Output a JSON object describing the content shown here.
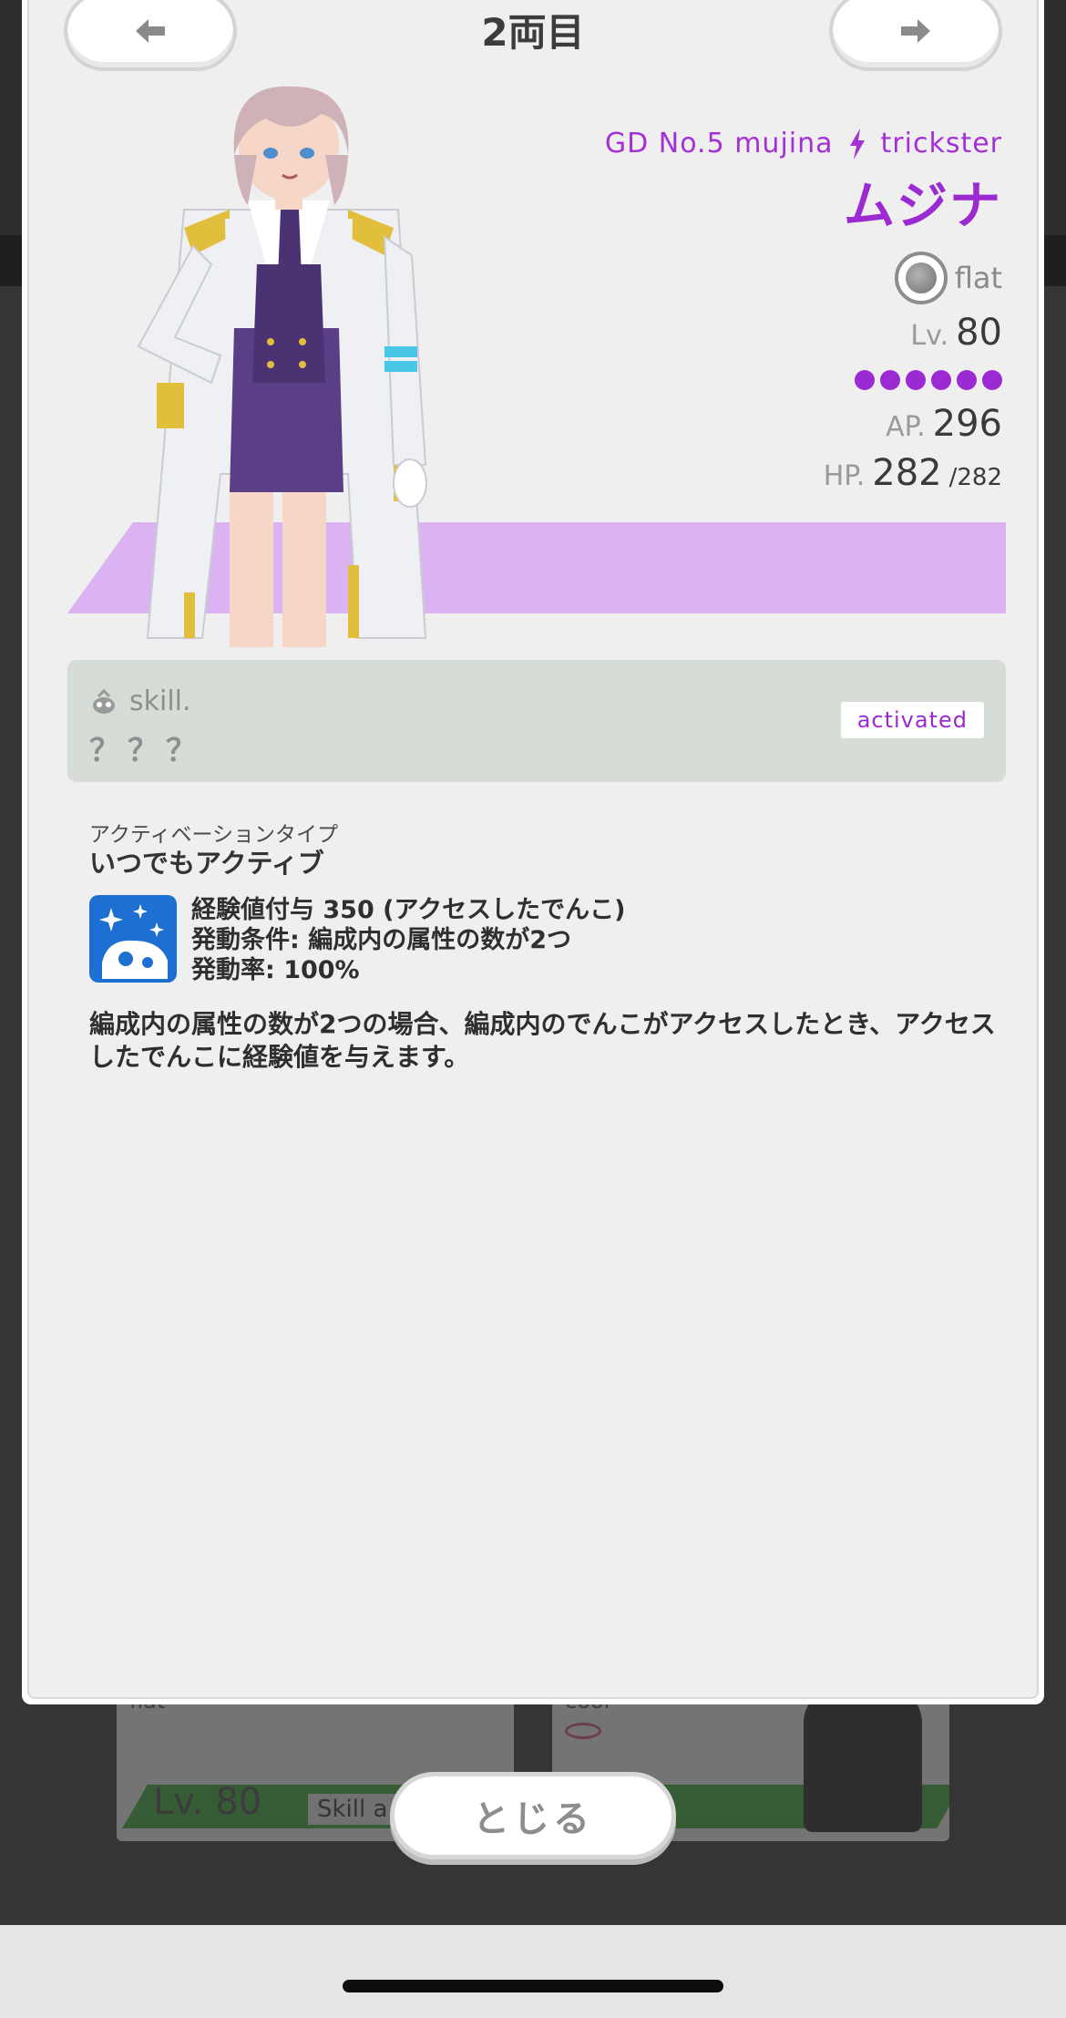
{
  "header": {
    "title": "2両目",
    "prev_icon": "arrow-left-icon",
    "next_icon": "arrow-right-icon"
  },
  "character": {
    "code": "GD No.5 mujina",
    "type": "trickster",
    "name": "ムジナ",
    "attribute": "flat",
    "level_label": "Lv.",
    "level": "80",
    "rarity_dots": 6,
    "ap_label": "AP.",
    "ap": "296",
    "hp_label": "HP.",
    "hp": "282",
    "hp_max": "/282",
    "accent_color": "#9c2ad3",
    "band_color": "#dbb2f2"
  },
  "skill": {
    "label": "skill.",
    "name": "？？？",
    "status": "activated"
  },
  "activation": {
    "type_label": "アクティベーションタイプ",
    "type_value": "いつでもアクティブ"
  },
  "effect": {
    "line1": "経験値付与 350 (アクセスしたでんこ)",
    "line2": "発動条件: 編成内の属性の数が2つ",
    "line3": "発動率: 100%",
    "description": "編成内の属性の数が2つの場合、編成内のでんこがアクセスしたとき、アクセスしたでんこに経験値を与えます。"
  },
  "footer": {
    "close_label": "とじる"
  },
  "background": {
    "card1_attr": "flat",
    "card1_lv_label": "Lv.",
    "card1_lv": "80",
    "card1_skill": "Skill a",
    "card2_attr": "cool"
  }
}
